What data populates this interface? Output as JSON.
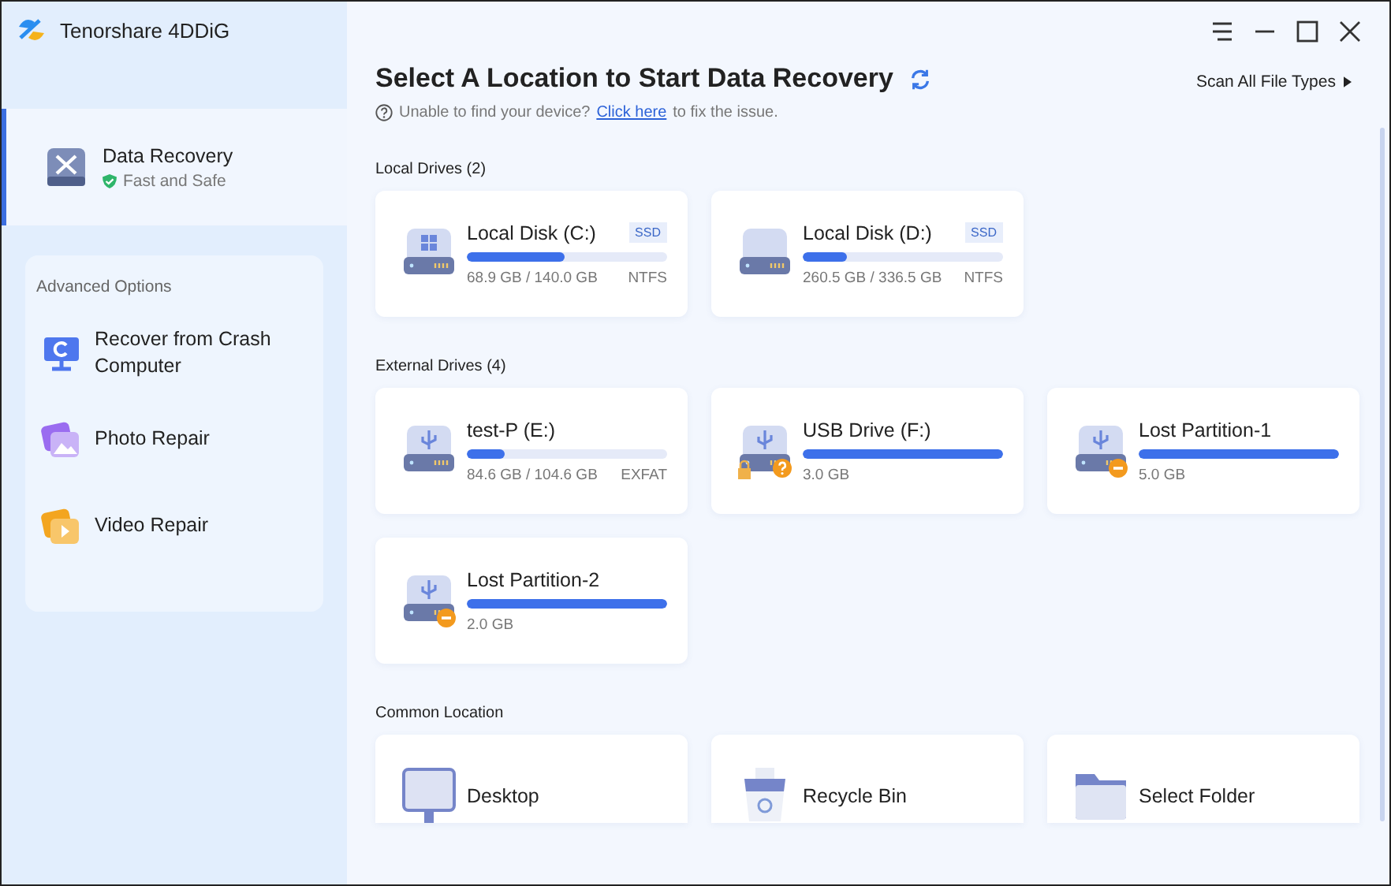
{
  "app": {
    "name": "Tenorshare 4DDiG"
  },
  "nav": {
    "title": "Data Recovery",
    "subtitle": "Fast and Safe",
    "selected": true
  },
  "advanced": {
    "heading": "Advanced Options",
    "items": [
      {
        "kind": "crash",
        "label": "Recover from Crash Computer"
      },
      {
        "kind": "photo",
        "label": "Photo Repair"
      },
      {
        "kind": "video",
        "label": "Video Repair"
      }
    ]
  },
  "header": {
    "title": "Select A Location to Start Data Recovery",
    "scan_all": "Scan All File Types",
    "help_before": "Unable to find your device?",
    "help_link": "Click here",
    "help_after": "to fix the issue."
  },
  "sections": [
    {
      "title": "Local Drives (2)",
      "drives": [
        {
          "kind": "system",
          "name": "Local Disk (C:)",
          "tag": "SSD",
          "level": 0.49,
          "size": "68.9 GB / 140.0 GB",
          "fs": "NTFS",
          "unknown": false,
          "lost": false,
          "locked": false
        },
        {
          "kind": "disk",
          "name": "Local Disk (D:)",
          "tag": "SSD",
          "level": 0.22,
          "size": "260.5 GB / 336.5 GB",
          "fs": "NTFS",
          "unknown": false,
          "lost": false,
          "locked": false
        }
      ]
    },
    {
      "title": "External Drives (4)",
      "drives": [
        {
          "kind": "usb",
          "name": "test-P (E:)",
          "level": 0.19,
          "size": "84.6 GB / 104.6 GB",
          "fs": "EXFAT",
          "unknown": false,
          "lost": false,
          "locked": false
        },
        {
          "kind": "usb",
          "name": "USB Drive (F:)",
          "level": 1,
          "size": "3.0 GB",
          "unknown": true,
          "lost": false,
          "locked": true
        },
        {
          "kind": "usb",
          "name": "Lost Partition-1",
          "level": 1,
          "size": "5.0 GB",
          "unknown": false,
          "lost": true,
          "locked": false
        },
        {
          "kind": "usb",
          "name": "Lost Partition-2",
          "level": 1,
          "size": "2.0 GB",
          "unknown": false,
          "lost": true,
          "locked": false
        }
      ]
    }
  ],
  "common": {
    "title": "Common Location",
    "items": [
      {
        "kind": "desktop",
        "label": "Desktop"
      },
      {
        "kind": "bin",
        "label": "Recycle Bin"
      },
      {
        "kind": "folder",
        "label": "Select Folder"
      }
    ]
  }
}
